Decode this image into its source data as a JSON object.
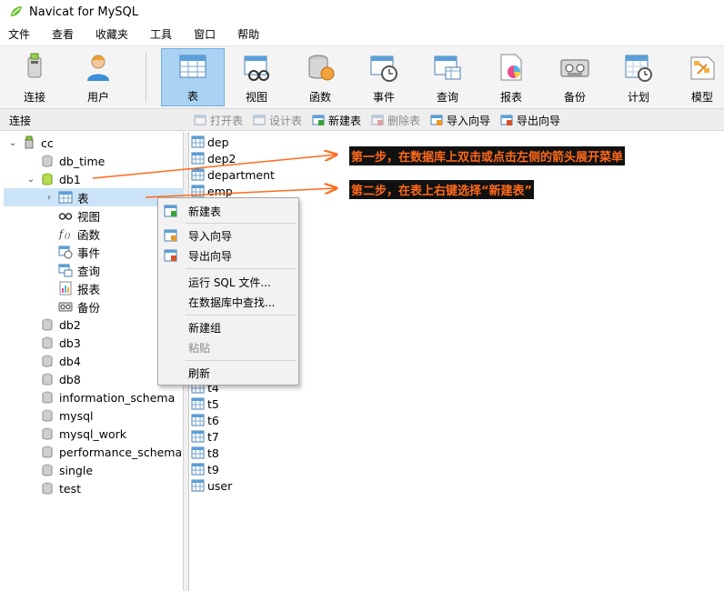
{
  "window": {
    "title": "Navicat for MySQL"
  },
  "menubar": {
    "items": [
      "文件",
      "查看",
      "收藏夹",
      "工具",
      "窗口",
      "帮助"
    ]
  },
  "toolbar": {
    "connect": "连接",
    "user": "用户",
    "table": "表",
    "view": "视图",
    "function": "函数",
    "event": "事件",
    "query": "查询",
    "report": "报表",
    "backup": "备份",
    "schedule": "计划",
    "model": "模型"
  },
  "subbar": {
    "connection_label": "连接",
    "open_table": "打开表",
    "design_table": "设计表",
    "new_table": "新建表",
    "delete_table": "删除表",
    "import_wizard": "导入向导",
    "export_wizard": "导出向导"
  },
  "tree": {
    "connection": "cc",
    "db_time": "db_time",
    "db1": "db1",
    "db1_children": {
      "tables": "表",
      "views": "视图",
      "functions": "函数",
      "events": "事件",
      "queries": "查询",
      "reports": "报表",
      "backups": "备份"
    },
    "db2": "db2",
    "db3": "db3",
    "db4": "db4",
    "db8": "db8",
    "information_schema": "information_schema",
    "mysql": "mysql",
    "mysql_work": "mysql_work",
    "performance_schema": "performance_schema",
    "single": "single",
    "test": "test"
  },
  "tables": {
    "dep": "dep",
    "dep2": "dep2",
    "department": "department",
    "emp": "emp",
    "t4": "t4",
    "t5": "t5",
    "t6": "t6",
    "t7": "t7",
    "t8": "t8",
    "t9": "t9",
    "user": "user"
  },
  "context_menu": {
    "new_table": "新建表",
    "import_wizard": "导入向导",
    "export_wizard": "导出向导",
    "run_sql": "运行 SQL 文件...",
    "find_in_db": "在数据库中查找...",
    "new_group": "新建组",
    "paste": "粘贴",
    "refresh": "刷新"
  },
  "annotations": {
    "step1": "第一步，在数据库上双击或点击左侧的箭头展开菜单",
    "step2": "第二步，在表上右键选择“新建表”"
  },
  "colors": {
    "accent": "#a9d2f3",
    "selected_row": "#cce4f7",
    "annotation": "#ff6a1a"
  }
}
